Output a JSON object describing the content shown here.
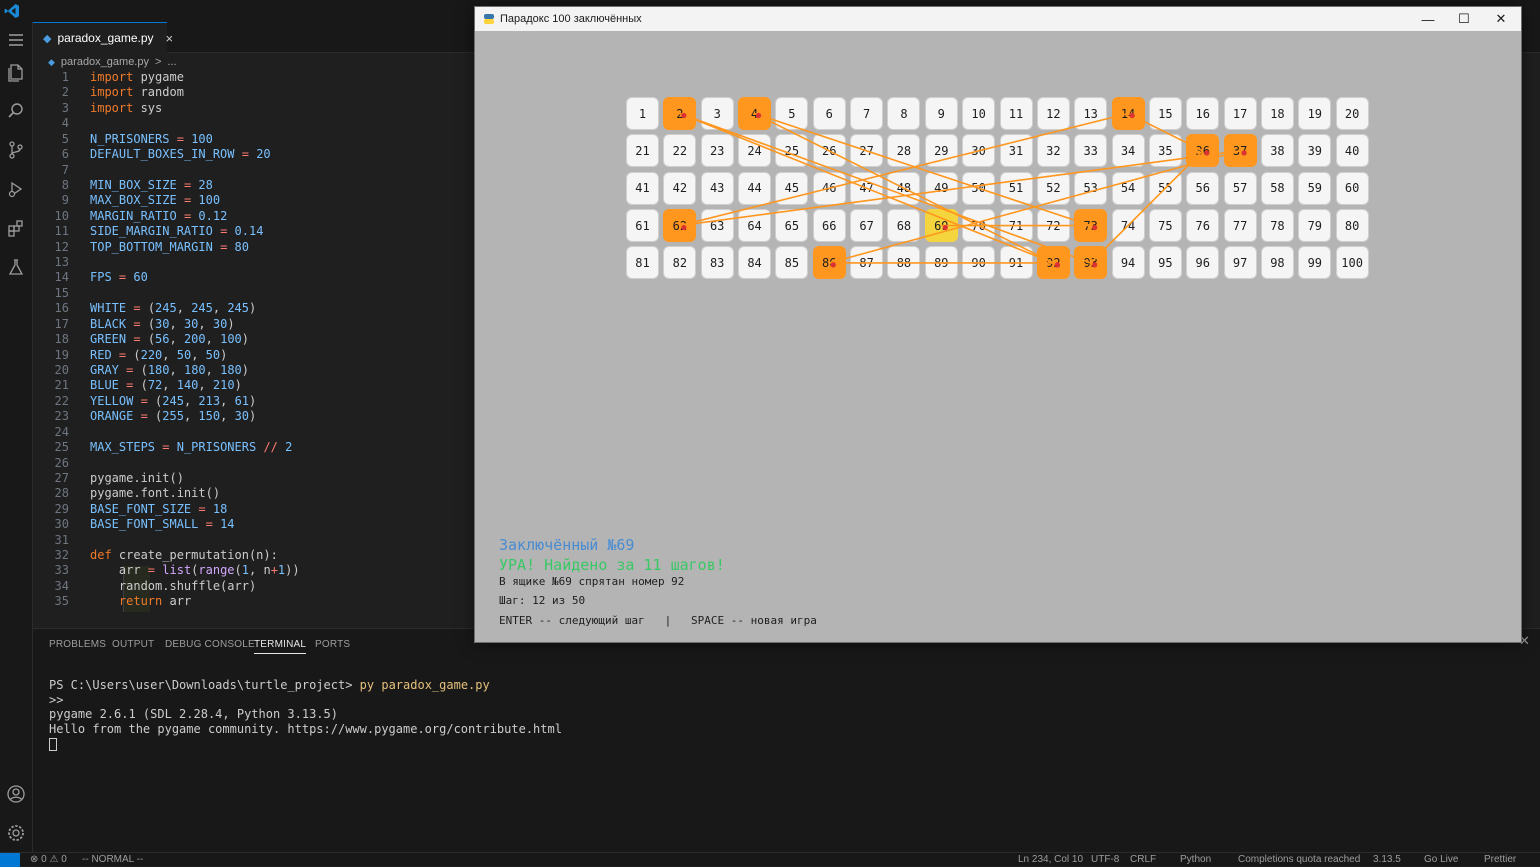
{
  "vscode": {
    "tab_label": "paradox_game.py",
    "tab_close": "×",
    "breadcrumb_file": "paradox_game.py",
    "breadcrumb_sep": ">",
    "breadcrumb_more": "...",
    "code_lines": [
      "import pygame",
      "import random",
      "import sys",
      "",
      "N_PRISONERS = 100",
      "DEFAULT_BOXES_IN_ROW = 20",
      "",
      "MIN_BOX_SIZE = 28",
      "MAX_BOX_SIZE = 100",
      "MARGIN_RATIO = 0.12",
      "SIDE_MARGIN_RATIO = 0.14",
      "TOP_BOTTOM_MARGIN = 80",
      "",
      "FPS = 60",
      "",
      "WHITE = (245, 245, 245)",
      "BLACK = (30, 30, 30)",
      "GREEN = (56, 200, 100)",
      "RED = (220, 50, 50)",
      "GRAY = (180, 180, 180)",
      "BLUE = (72, 140, 210)",
      "YELLOW = (245, 213, 61)",
      "ORANGE = (255, 150, 30)",
      "",
      "MAX_STEPS = N_PRISONERS // 2",
      "",
      "pygame.init()",
      "pygame.font.init()",
      "BASE_FONT_SIZE = 18",
      "BASE_FONT_SMALL = 14",
      "",
      "def create_permutation(n):",
      "    arr = list(range(1, n+1))",
      "    random.shuffle(arr)",
      "    return arr"
    ],
    "panel_tabs": [
      "PROBLEMS",
      "OUTPUT",
      "DEBUG CONSOLE",
      "TERMINAL",
      "PORTS"
    ],
    "terminal": {
      "prompt": "PS C:\\Users\\user\\Downloads\\turtle_project> ",
      "command": "py paradox_game.py",
      "lines": [
        ">>",
        "pygame 2.6.1 (SDL 2.28.4, Python 3.13.5)",
        "Hello from the pygame community. https://www.pygame.org/contribute.html"
      ]
    },
    "status": {
      "problems": "⊗ 0 ⚠ 0",
      "mode": "-- NORMAL --",
      "position": "Ln 234, Col 10",
      "encoding": "UTF-8",
      "eol": "CRLF",
      "language": "Python",
      "quota": "Completions quota reached",
      "version": "3.13.5",
      "golive": "Go Live",
      "prettier": "Prettier"
    }
  },
  "game": {
    "title": "Парадокс 100 заключённых",
    "boxes_per_row": 20,
    "box_count": 100,
    "visited": [
      2,
      4,
      14,
      36,
      37,
      62,
      73,
      86,
      92,
      93
    ],
    "current": 69,
    "path": [
      69,
      73,
      4,
      92,
      2,
      93,
      36,
      14,
      62,
      37,
      86,
      92
    ],
    "text": {
      "prisoner": "Заключённый №69",
      "success": "УРА! Найдено за 11 шагов!",
      "box_info": "В ящике №69 спрятан номер 92",
      "step": "Шаг: 12 из 50",
      "controls": "ENTER -- следующий шаг   |   SPACE -- новая игра"
    },
    "colors": {
      "background": "#b4b4b4",
      "box": "#f5f5f5",
      "visited": "#ff961e",
      "current": "#f5d53d",
      "prisoner_text": "#488cd2",
      "success_text": "#38c864",
      "text": "#1e1e1e",
      "marker": "#dc3232"
    }
  }
}
